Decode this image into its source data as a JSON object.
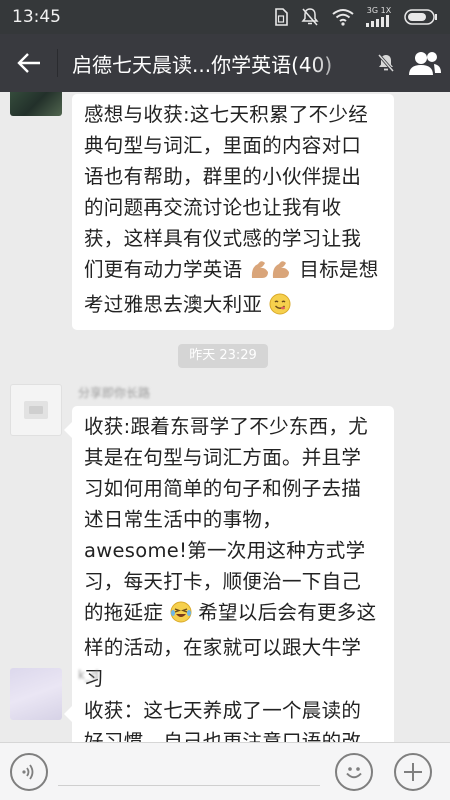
{
  "status_bar": {
    "time": "13:45",
    "network_label": "3G 1X",
    "icons": [
      "sim-icon",
      "mute-icon",
      "wifi-icon",
      "signal-icon",
      "battery-icon"
    ]
  },
  "header": {
    "title": "启德七天晨读...你学英语(40)",
    "back_icon": "back-arrow-icon",
    "mute_icon": "mute-bell-icon",
    "members_icon": "group-members-icon"
  },
  "timestamp": "昨天 23:29",
  "messages": [
    {
      "sender": "",
      "text_before_emoji": "感想与收获:这七天积累了不少经典句型与词汇，里面的内容对口语也有帮助，群里的小伙伴提出的问题再交流讨论也让我有收获，这样具有仪式感的学习让我们更有动力学英语",
      "emoji_1": "flexed-biceps-emoji",
      "text_middle": "目标是想考过雅思去澳大利亚",
      "emoji_2": "yum-face-emoji"
    },
    {
      "sender": "分享即你长路",
      "text_before_emoji": "收获:跟着东哥学了不少东西，尤其是在句型与词汇方面。并且学习如何用简单的句子和例子去描述日常生活中的事物，awesome!第一次用这种方式学习，每天打卡，顺便治一下自己的拖延症",
      "emoji_1": "laughing-tears-emoji",
      "text_middle": "希望以后会有更多这样的活动，在家就可以跟大牛学习"
    },
    {
      "sender": "k_d",
      "text": "收获：这七天养成了一个晨读的好习惯，自己也更注意口语的改善和"
    }
  ],
  "input_bar": {
    "voice_icon": "voice-icon",
    "emoji_icon": "smiley-icon",
    "plus_icon": "plus-icon"
  },
  "colors": {
    "status_bar": "#35383a",
    "title_bar": "#393a3f",
    "chat_bg": "#ebebeb",
    "bubble": "#ffffff",
    "timestamp_bg": "#d5d5d5"
  }
}
